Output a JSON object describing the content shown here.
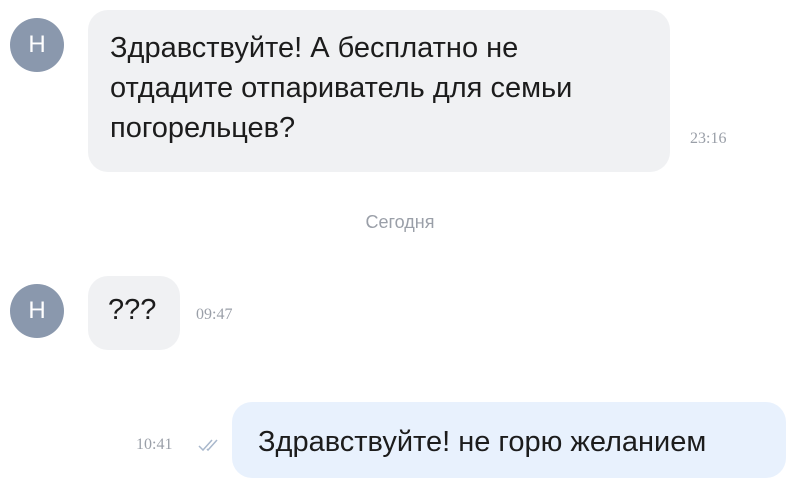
{
  "messages": [
    {
      "sender_initial": "Н",
      "text": "Здравствуйте! А бесплатно не\nотдадите отпариватель для семьи\nпогорельцев?",
      "time": "23:16"
    },
    {
      "sender_initial": "Н",
      "text": "???",
      "time": "09:47"
    }
  ],
  "date_divider": "Сегодня",
  "outgoing": {
    "text": "Здравствуйте! не горю желанием",
    "time": "10:41",
    "status_icon": "double-check-icon",
    "status": "read"
  },
  "colors": {
    "avatar": "#8a98ad",
    "incoming_bubble": "#f0f1f3",
    "outgoing_bubble": "#e8f1fd",
    "timestamp": "#9a9fa8",
    "check": "#a9b8cc"
  }
}
